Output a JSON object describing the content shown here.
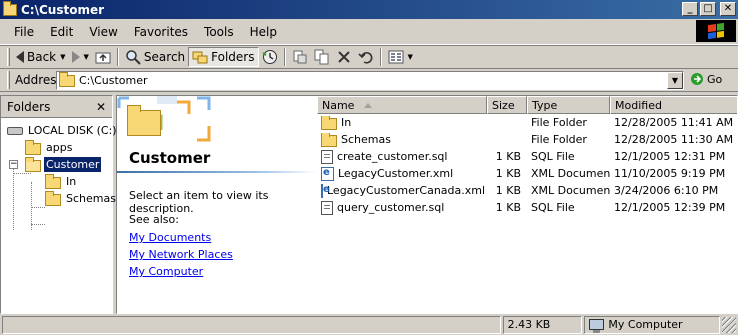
{
  "window": {
    "title": "C:\\Customer",
    "min": "_",
    "max": "□",
    "close": "✕"
  },
  "menu": [
    "File",
    "Edit",
    "View",
    "Favorites",
    "Tools",
    "Help"
  ],
  "toolbar": {
    "back": "Back",
    "search": "Search",
    "folders": "Folders"
  },
  "address": {
    "label": "Address",
    "value": "C:\\Customer",
    "go": "Go"
  },
  "folders_pane": {
    "title": "Folders",
    "close": "✕",
    "tree": [
      {
        "label": "LOCAL DISK (C:)",
        "toggle": "−"
      },
      {
        "label": "apps"
      },
      {
        "label": "Customer",
        "toggle": "−",
        "selected": true
      },
      {
        "label": "In"
      },
      {
        "label": "Schemas"
      }
    ]
  },
  "webview": {
    "title": "Customer",
    "description": "Select an item to view its description.",
    "see_also": "See also:",
    "links": [
      "My Documents",
      "My Network Places",
      "My Computer"
    ]
  },
  "list": {
    "columns": {
      "name": "Name",
      "size": "Size",
      "type": "Type",
      "modified": "Modified"
    },
    "rows": [
      {
        "name": "In",
        "icon": "folder-icon",
        "size": "",
        "type": "File Folder",
        "modified": "12/28/2005 11:41 AM"
      },
      {
        "name": "Schemas",
        "icon": "folder-icon",
        "size": "",
        "type": "File Folder",
        "modified": "12/28/2005 11:30 AM"
      },
      {
        "name": "create_customer.sql",
        "icon": "sql-file-icon",
        "size": "1 KB",
        "type": "SQL File",
        "modified": "12/1/2005 12:31 PM"
      },
      {
        "name": "LegacyCustomer.xml",
        "icon": "xml-file-icon",
        "size": "1 KB",
        "type": "XML Document",
        "modified": "11/10/2005 9:19 PM"
      },
      {
        "name": "LegacyCustomerCanada.xml",
        "icon": "xml-file-icon",
        "size": "1 KB",
        "type": "XML Document",
        "modified": "3/24/2006 6:10 PM"
      },
      {
        "name": "query_customer.sql",
        "icon": "sql-file-icon",
        "size": "1 KB",
        "type": "SQL File",
        "modified": "12/1/2005 12:39 PM"
      }
    ]
  },
  "status": {
    "size": "2.43 KB",
    "location": "My Computer"
  }
}
